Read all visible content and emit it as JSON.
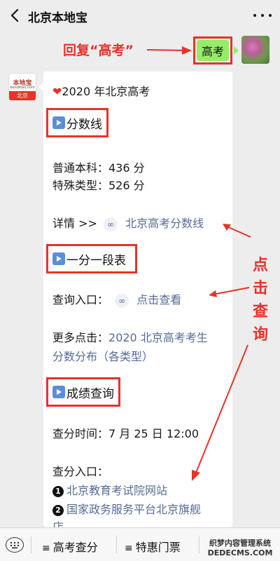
{
  "header": {
    "title": "北京本地宝"
  },
  "annotations": {
    "reply_hint": "回复“高考”",
    "click_hint": [
      "点",
      "击",
      "查",
      "询"
    ]
  },
  "chat": {
    "user_message": "高考",
    "card": {
      "intro": "2020 年北京高考",
      "section1": {
        "heading": "分数线",
        "line1": "普通本科：436 分",
        "line2": "特殊类型：526 分",
        "detail_prefix": "详情 >>",
        "detail_link": "北京高考分数线"
      },
      "section2": {
        "heading": "一分一段表",
        "query_prefix": "查询入口：",
        "query_link": "点击查看",
        "more_prefix": "更多点击：",
        "more_link_line1": "2020 北京高考考生",
        "more_link_line2": "分数分布（各类型）"
      },
      "section3": {
        "heading": "成绩查询",
        "time_line": "查分时间：7 月 25 日 12:00",
        "entry_label": "查分入口：",
        "entry1_num": "1",
        "entry1": "北京教育考试院网站",
        "entry2_num": "2",
        "entry2": "国家政务服务平台北京旗舰",
        "entry2_cont": "店"
      }
    }
  },
  "bot_avatar": {
    "logo_top": "本地宝",
    "logo_mid": "bendibao.com",
    "logo_bottom": "北京"
  },
  "bottom_menu": {
    "items": [
      "高考查分",
      "特惠门票"
    ]
  },
  "watermark": {
    "line1": "织梦内容管理系统",
    "line2": "DEDECMS.COM"
  },
  "colors": {
    "annotation_red": "#e8322a",
    "link_blue": "#576b95",
    "bubble_green": "#95ec69"
  }
}
